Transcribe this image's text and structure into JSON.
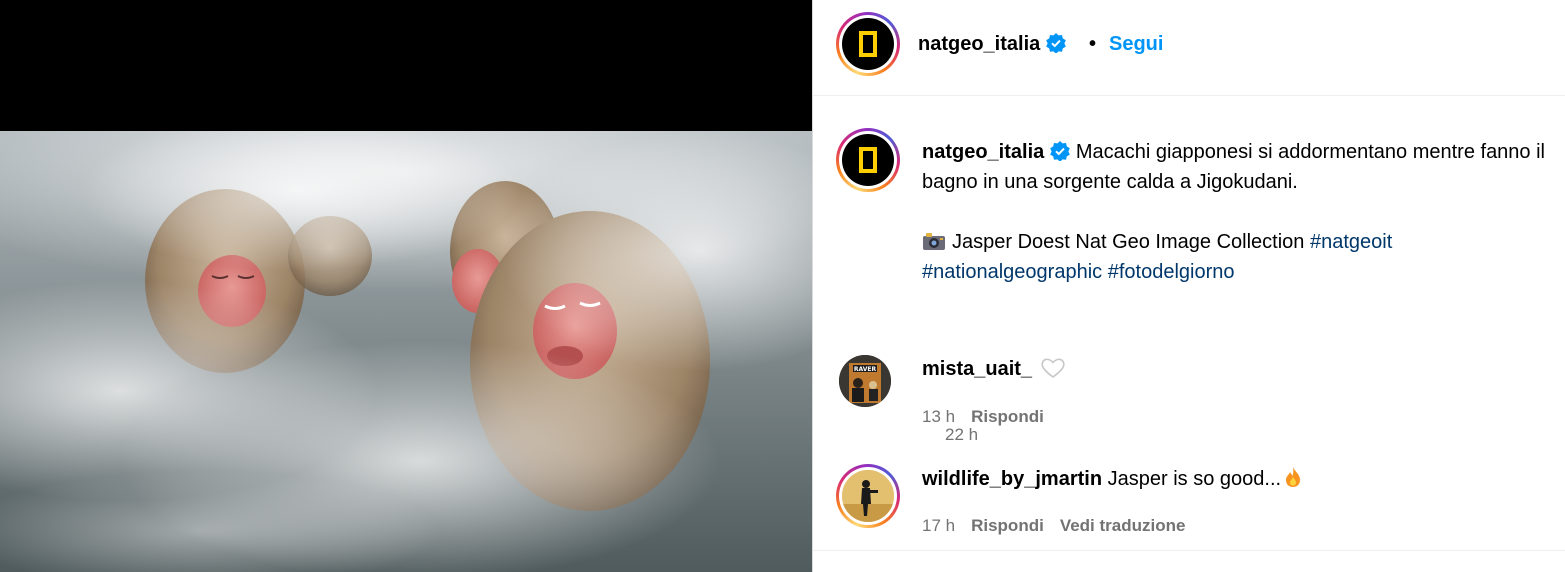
{
  "post": {
    "username": "natgeo_italia",
    "follow_label": "Segui",
    "dot": "•",
    "caption_text": "Macachi giapponesi si addormentano mentre fanno il bagno in una sorgente calda a Jigokudani.",
    "credit_text": "Jasper Doest Nat Geo Image Collection",
    "hashtags": [
      "#natgeoit",
      "#nationalgeographic",
      "#fotodelgiorno"
    ],
    "time": "22 h"
  },
  "comments": [
    {
      "username": "mista_uait_",
      "text": "",
      "time": "13 h",
      "reply_label": "Rispondi",
      "avatar_label": "RAVER"
    },
    {
      "username": "wildlife_by_jmartin",
      "text": "Jasper is so good...",
      "time": "17 h",
      "reply_label": "Rispondi",
      "translate_label": "Vedi traduzione"
    }
  ],
  "icons": {
    "verified": "verified-badge-icon",
    "camera": "camera-emoji-icon",
    "heart": "heart-outline-icon",
    "fire": "fire-emoji-icon"
  },
  "colors": {
    "link_blue": "#0095f6",
    "hashtag": "#00376b",
    "secondary_text": "#737373",
    "verified": "#0095f6",
    "logo_yellow": "#ffce00"
  }
}
